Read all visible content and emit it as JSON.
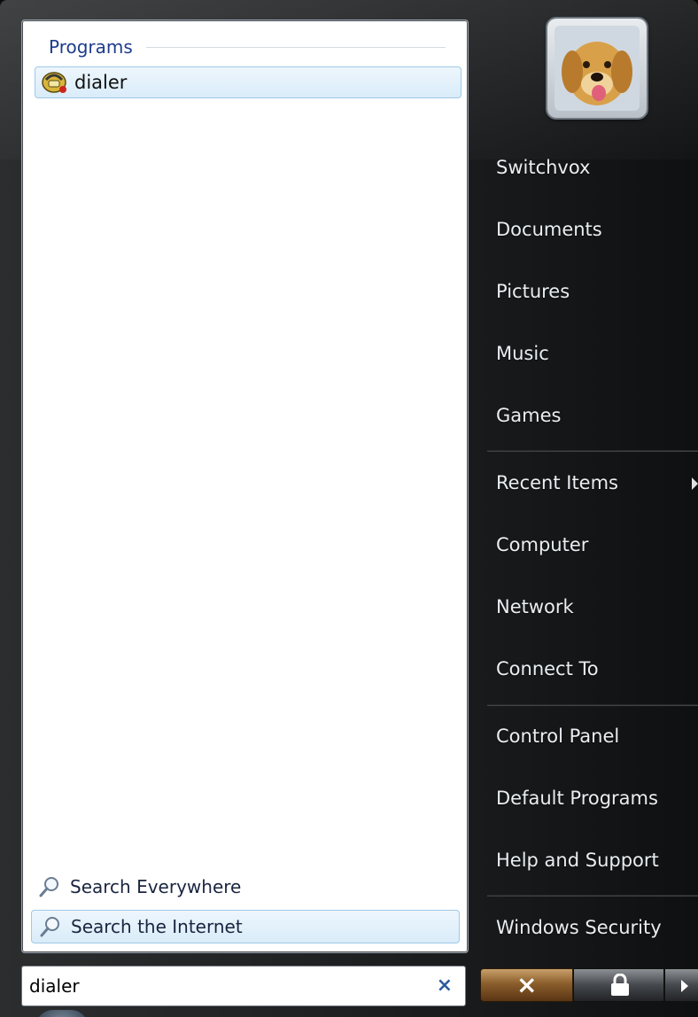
{
  "left_pane": {
    "programs_header": "Programs",
    "programs": [
      {
        "label": "dialer",
        "icon": "dialer-phone-icon"
      }
    ],
    "search_everywhere": "Search Everywhere",
    "search_internet": "Search the Internet"
  },
  "search": {
    "value": "dialer",
    "clear_icon": "×"
  },
  "user": {
    "picture": "dog-avatar"
  },
  "right_menu": {
    "group1": [
      "Switchvox",
      "Documents",
      "Pictures",
      "Music",
      "Games"
    ],
    "group2": [
      "Recent Items",
      "Computer",
      "Network",
      "Connect To"
    ],
    "group3": [
      "Control Panel",
      "Default Programs",
      "Help and Support"
    ],
    "group4": [
      "Windows Security"
    ]
  },
  "buttons": {
    "power_icon": "×",
    "lock_icon": "lock-icon",
    "more_icon": "arrow-right-icon"
  },
  "colors": {
    "accent_blue": "#1d3c8c",
    "highlight": "#d9ecf9",
    "menu_text": "#e9eef2",
    "power_orange": "#8b5e2c"
  }
}
